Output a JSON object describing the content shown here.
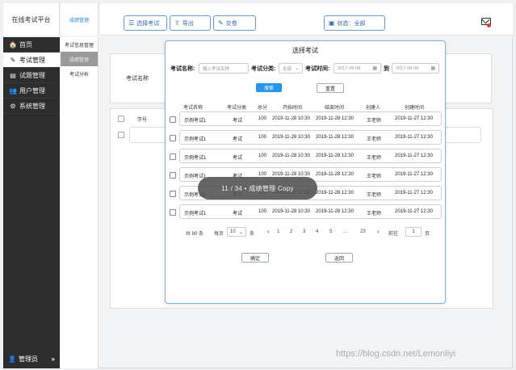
{
  "app": {
    "title": "在线考试平台",
    "section": "成绩管理"
  },
  "sidebar": {
    "items": [
      {
        "label": "首页",
        "icon": "home-icon",
        "glyph": "🏠"
      },
      {
        "label": "考试管理",
        "icon": "pencil-icon",
        "glyph": "✎"
      },
      {
        "label": "试题管理",
        "icon": "document-icon",
        "glyph": "▤"
      },
      {
        "label": "用户管理",
        "icon": "users-icon",
        "glyph": "👥"
      },
      {
        "label": "系统管理",
        "icon": "gears-icon",
        "glyph": "⚙"
      }
    ],
    "footer_label": "管理员",
    "footer_chevron": "»"
  },
  "submenu": {
    "items": [
      "考试信息管理",
      "成绩管理",
      "考试分析"
    ]
  },
  "toolbar": {
    "select_exam": "选择考试",
    "export": "导出",
    "submit": "交卷",
    "status": "状态：全部"
  },
  "background": {
    "exam_name_label": "考试名称",
    "student_no_label": "学号"
  },
  "modal": {
    "title": "选择考试",
    "name_label": "考试名称:",
    "name_placeholder": "输入考试名称",
    "category_label": "考试分类:",
    "category_value": "全部",
    "time_label": "考试时间:",
    "date_from": "2017-08-08",
    "date_to": "2017-08-08",
    "to_label": "到",
    "search_btn": "搜索",
    "reset_btn": "重置",
    "columns": [
      "考试名称",
      "考试分类",
      "总分",
      "开始时间",
      "结束时间",
      "创建人",
      "创建时间"
    ],
    "rows": [
      [
        "示例考试1",
        "考试",
        "100",
        "2019-11-28 10:30",
        "2019-11-28 12:30",
        "王老师",
        "2019-11-27 12:30"
      ],
      [
        "示例考试1",
        "考试",
        "100",
        "2019-11-28 10:30",
        "2019-11-28 12:30",
        "王老师",
        "2019-11-27 12:30"
      ],
      [
        "示例考试1",
        "考试",
        "100",
        "2019-11-28 10:30",
        "2019-11-28 12:30",
        "王老师",
        "2019-11-27 12:30"
      ],
      [
        "示例考试1",
        "考试",
        "100",
        "2019-11-28 10:30",
        "2019-11-28 12:30",
        "王老师",
        "2019-11-27 12:30"
      ],
      [
        "示例考试1",
        "考试",
        "100",
        "2019-11-28 10:30",
        "2019-11-28 12:30",
        "王老师",
        "2019-11-27 12:30"
      ],
      [
        "示例考试1",
        "考试",
        "100",
        "2019-11-28 10:30",
        "2019-11-28 12:30",
        "王老师",
        "2019-11-27 12:30"
      ]
    ],
    "pager": {
      "total": "共 80 条",
      "per_page_label": "每页",
      "per_page_value": "10",
      "per_page_unit": "条",
      "prev": "‹",
      "pages": [
        "1",
        "2",
        "3",
        "4",
        "5",
        "...",
        "23"
      ],
      "next": "›",
      "goto_label": "前往",
      "goto_value": "1",
      "goto_unit": "页"
    },
    "confirm_btn": "确定",
    "back_btn": "返回"
  },
  "toast": {
    "text": "11 / 34  •  成绩管理 Copy"
  },
  "watermark": "https://blog.csdn.net/Lemonliyi"
}
